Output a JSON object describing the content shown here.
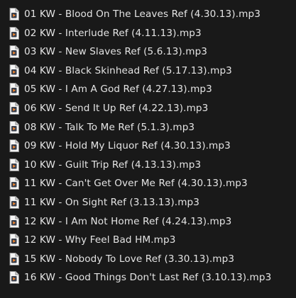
{
  "files": [
    {
      "name": "01 KW - Blood On The Leaves Ref (4.30.13).mp3",
      "icon": "audio-file-icon"
    },
    {
      "name": "02 KW - Interlude Ref (4.11.13).mp3",
      "icon": "audio-file-icon"
    },
    {
      "name": "03 KW - New Slaves Ref (5.6.13).mp3",
      "icon": "audio-file-icon"
    },
    {
      "name": "04 KW - Black Skinhead Ref (5.17.13).mp3",
      "icon": "audio-file-icon"
    },
    {
      "name": "05 KW - I Am A God Ref (4.27.13).mp3",
      "icon": "audio-file-icon"
    },
    {
      "name": "06 KW - Send It Up Ref (4.22.13).mp3",
      "icon": "audio-file-icon"
    },
    {
      "name": "08 KW - Talk To Me Ref (5.1.3).mp3",
      "icon": "audio-file-icon"
    },
    {
      "name": "09 KW - Hold My Liquor Ref (4.30.13).mp3",
      "icon": "audio-file-icon"
    },
    {
      "name": "10 KW - Guilt Trip Ref (4.13.13).mp3",
      "icon": "audio-file-icon"
    },
    {
      "name": "11 KW - Can't Get Over Me Ref (4.30.13).mp3",
      "icon": "audio-file-icon"
    },
    {
      "name": "11 KW - On Sight Ref (3.13.13).mp3",
      "icon": "audio-file-icon"
    },
    {
      "name": "12 KW - I Am Not Home Ref (4.24.13).mp3",
      "icon": "audio-file-icon"
    },
    {
      "name": "12 KW - Why Feel Bad HM.mp3",
      "icon": "audio-file-icon"
    },
    {
      "name": "15 KW - Nobody To Love Ref (3.30.13).mp3",
      "icon": "audio-file-icon"
    },
    {
      "name": "16 KW - Good Things Don't Last Ref (3.10.13).mp3",
      "icon": "audio-file-icon"
    }
  ]
}
